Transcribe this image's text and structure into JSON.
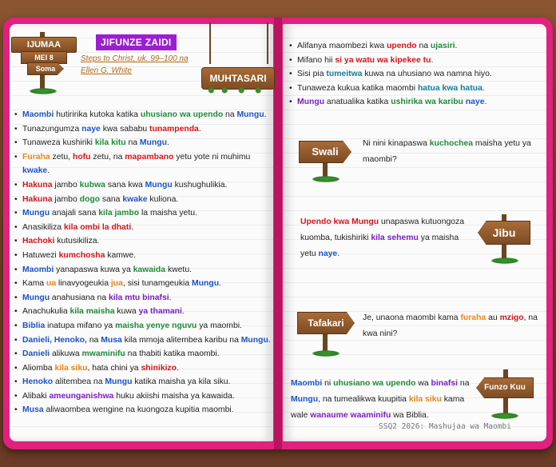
{
  "header": {
    "day": "IJUMAA",
    "date": "MEI 8",
    "soma": "Soma",
    "section_title": "JIFUNZE ZAIDI",
    "reference_line1": "Steps to Christ, uk. 99–100 na",
    "reference_line2": "Ellen G. White",
    "summary_sign": "MUHTASARI"
  },
  "left_list": [
    [
      {
        "t": "Maombi",
        "c": "blue"
      },
      {
        "t": " hutiririka kutoka katika "
      },
      {
        "t": "uhusiano wa upendo",
        "c": "green"
      },
      {
        "t": " na "
      },
      {
        "t": "Mungu",
        "c": "blue"
      },
      {
        "t": "."
      }
    ],
    [
      {
        "t": "Tunazungumza "
      },
      {
        "t": "naye",
        "c": "blue"
      },
      {
        "t": " kwa sababu "
      },
      {
        "t": "tunampenda",
        "c": "red"
      },
      {
        "t": "."
      }
    ],
    [
      {
        "t": "Tunaweza kushiriki "
      },
      {
        "t": "kila kitu",
        "c": "green"
      },
      {
        "t": " na "
      },
      {
        "t": "Mungu",
        "c": "blue"
      },
      {
        "t": "."
      }
    ],
    [
      {
        "t": "Furaha",
        "c": "orange"
      },
      {
        "t": " zetu, "
      },
      {
        "t": "hofu",
        "c": "red"
      },
      {
        "t": " zetu, na "
      },
      {
        "t": "mapambano",
        "c": "red"
      },
      {
        "t": " yetu yote ni muhimu "
      },
      {
        "t": "kwake",
        "c": "blue"
      },
      {
        "t": "."
      }
    ],
    [
      {
        "t": "Hakuna",
        "c": "red"
      },
      {
        "t": " jambo "
      },
      {
        "t": "kubwa",
        "c": "green"
      },
      {
        "t": " sana kwa "
      },
      {
        "t": "Mungu",
        "c": "blue"
      },
      {
        "t": " kushughulikia."
      }
    ],
    [
      {
        "t": "Hakuna",
        "c": "red"
      },
      {
        "t": " jambo "
      },
      {
        "t": "dogo",
        "c": "green"
      },
      {
        "t": " sana "
      },
      {
        "t": "kwake",
        "c": "blue"
      },
      {
        "t": " kuliona."
      }
    ],
    [
      {
        "t": "Mungu",
        "c": "blue"
      },
      {
        "t": " anajali sana "
      },
      {
        "t": "kila jambo",
        "c": "green"
      },
      {
        "t": " la maisha yetu."
      }
    ],
    [
      {
        "t": "Anasikiliza "
      },
      {
        "t": "kila ombi la dhati",
        "c": "red"
      },
      {
        "t": "."
      }
    ],
    [
      {
        "t": "Hachoki",
        "c": "red"
      },
      {
        "t": " kutusikiliza."
      }
    ],
    [
      {
        "t": "Hatuwezi "
      },
      {
        "t": "kumchosha",
        "c": "red"
      },
      {
        "t": " kamwe."
      }
    ],
    [
      {
        "t": "Maombi",
        "c": "blue"
      },
      {
        "t": " yanapaswa kuwa ya "
      },
      {
        "t": "kawaida",
        "c": "green"
      },
      {
        "t": " kwetu."
      }
    ],
    [
      {
        "t": "Kama "
      },
      {
        "t": "ua",
        "c": "orange"
      },
      {
        "t": " linavyogeukia "
      },
      {
        "t": "jua",
        "c": "orange"
      },
      {
        "t": ", sisi tunamgeukia "
      },
      {
        "t": "Mungu",
        "c": "blue"
      },
      {
        "t": "."
      }
    ],
    [
      {
        "t": "Mungu",
        "c": "blue"
      },
      {
        "t": " anahusiana na "
      },
      {
        "t": "kila mtu binafsi",
        "c": "purple"
      },
      {
        "t": "."
      }
    ],
    [
      {
        "t": "Anachukulia "
      },
      {
        "t": "kila maisha",
        "c": "green"
      },
      {
        "t": " kuwa "
      },
      {
        "t": "ya thamani",
        "c": "purple"
      },
      {
        "t": "."
      }
    ],
    [
      {
        "t": "Biblia",
        "c": "blue"
      },
      {
        "t": " inatupa mifano ya "
      },
      {
        "t": "maisha yenye nguvu",
        "c": "green"
      },
      {
        "t": " ya maombi."
      }
    ],
    [
      {
        "t": "Danieli, Henoko,",
        "c": "blue"
      },
      {
        "t": " na "
      },
      {
        "t": "Musa",
        "c": "blue"
      },
      {
        "t": " kila mmoja alitembea karibu na "
      },
      {
        "t": "Mungu",
        "c": "blue"
      },
      {
        "t": "."
      }
    ],
    [
      {
        "t": "Danieli",
        "c": "blue"
      },
      {
        "t": " alikuwa "
      },
      {
        "t": "mwaminifu",
        "c": "green"
      },
      {
        "t": " na thabiti katika maombi."
      }
    ],
    [
      {
        "t": "Aliomba "
      },
      {
        "t": "kila siku",
        "c": "orange"
      },
      {
        "t": ", hata chini ya "
      },
      {
        "t": "shinikizo",
        "c": "red"
      },
      {
        "t": "."
      }
    ],
    [
      {
        "t": "Henoko",
        "c": "blue"
      },
      {
        "t": " alitembea na "
      },
      {
        "t": "Mungu",
        "c": "blue"
      },
      {
        "t": " katika maisha ya kila siku."
      }
    ],
    [
      {
        "t": "Alibaki "
      },
      {
        "t": "ameunganishwa",
        "c": "purple"
      },
      {
        "t": " huku akiishi maisha ya kawaida."
      }
    ],
    [
      {
        "t": "Musa",
        "c": "blue"
      },
      {
        "t": " aliwaombea wengine na kuongoza kupitia maombi."
      }
    ]
  ],
  "right_list": [
    [
      {
        "t": "Alifanya maombezi kwa "
      },
      {
        "t": "upendo",
        "c": "red"
      },
      {
        "t": " na "
      },
      {
        "t": "ujasiri",
        "c": "green"
      },
      {
        "t": "."
      }
    ],
    [
      {
        "t": "Mifano hii "
      },
      {
        "t": "si ya watu wa kipekee tu",
        "c": "red"
      },
      {
        "t": "."
      }
    ],
    [
      {
        "t": "Sisi pia "
      },
      {
        "t": "tumeitwa",
        "c": "teal"
      },
      {
        "t": " kuwa na uhusiano wa namna hiyo."
      }
    ],
    [
      {
        "t": "Tunaweza kukua katika maombi "
      },
      {
        "t": "hatua kwa hatua",
        "c": "teal"
      },
      {
        "t": "."
      }
    ],
    [
      {
        "t": "Mungu",
        "c": "purple"
      },
      {
        "t": " anatualika katika "
      },
      {
        "t": "ushirika wa karibu",
        "c": "green"
      },
      {
        "t": " "
      },
      {
        "t": "naye",
        "c": "blue"
      },
      {
        "t": "."
      }
    ]
  ],
  "swali": {
    "label": "Swali",
    "text": [
      {
        "t": "Ni nini kinapaswa "
      },
      {
        "t": "kuchochea",
        "c": "green"
      },
      {
        "t": " maisha yetu ya maombi?"
      }
    ]
  },
  "jibu": {
    "label": "Jibu",
    "text": [
      {
        "t": "Upendo kwa Mungu",
        "c": "red"
      },
      {
        "t": " unapaswa kutuongoza kuomba, tukishiriki "
      },
      {
        "t": "kila sehemu",
        "c": "purple"
      },
      {
        "t": " ya maisha yetu "
      },
      {
        "t": "naye",
        "c": "blue"
      },
      {
        "t": "."
      }
    ]
  },
  "tafakari": {
    "label": "Tafakari",
    "text": [
      {
        "t": "Je, unaona maombi kama "
      },
      {
        "t": "furaha",
        "c": "orange"
      },
      {
        "t": " au "
      },
      {
        "t": "mzigo",
        "c": "red"
      },
      {
        "t": ", na kwa nini?"
      }
    ]
  },
  "funzo": {
    "label": "Funzo Kuu",
    "text": [
      {
        "t": "Maombi",
        "c": "blue"
      },
      {
        "t": " ni "
      },
      {
        "t": "uhusiano wa upendo",
        "c": "green"
      },
      {
        "t": " wa "
      },
      {
        "t": "binafsi",
        "c": "purple"
      },
      {
        "t": " na "
      },
      {
        "t": "Mungu",
        "c": "blue"
      },
      {
        "t": ", na tumealikwa kuupitia "
      },
      {
        "t": "kila siku",
        "c": "orange"
      },
      {
        "t": " kama wale "
      },
      {
        "t": "wanaume waaminifu",
        "c": "purple"
      },
      {
        "t": " wa Biblia."
      }
    ]
  },
  "footer": "SSQ2 2026: Mashujaa wa Maombi",
  "colors": {
    "cover": "#e0217f",
    "wood": "#8a5530",
    "blue": "#1b55c8",
    "green": "#1f8c3a",
    "red": "#d4161b",
    "orange": "#e8871a",
    "purple": "#7a1fc0"
  }
}
